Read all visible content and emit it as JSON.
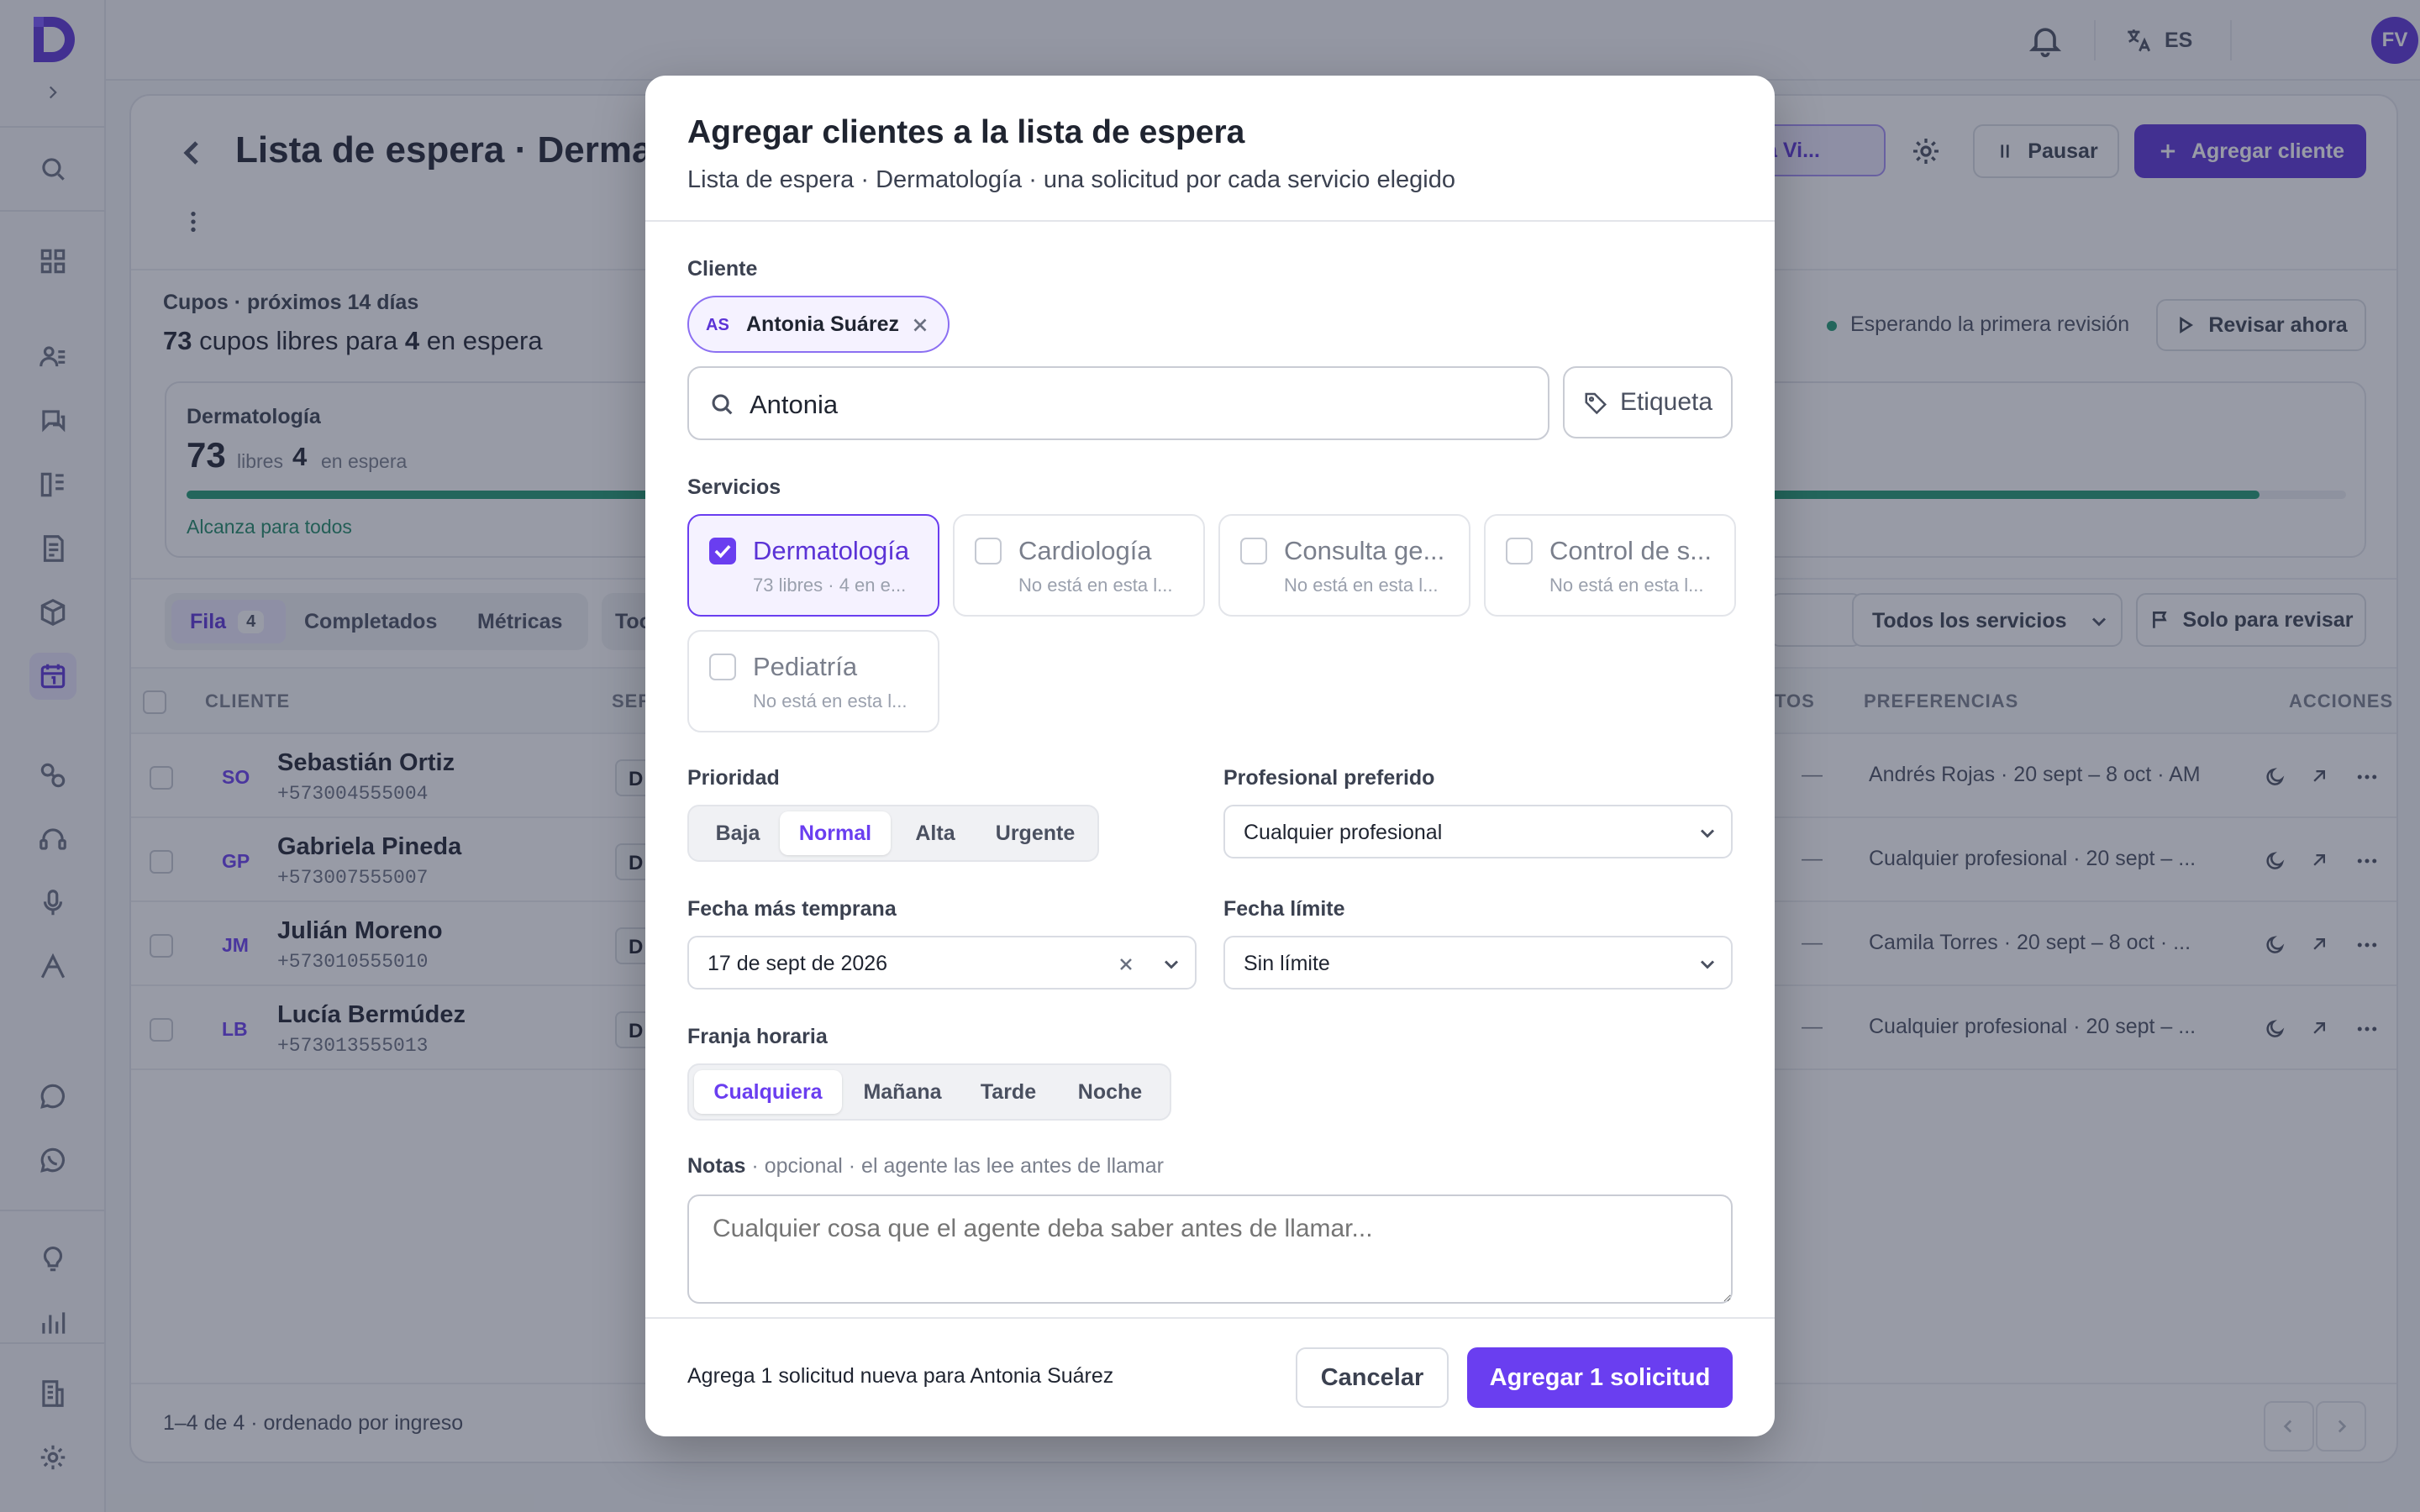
{
  "topbar": {
    "language": "ES",
    "user_initials": "FV"
  },
  "page": {
    "title": "Lista de espera · Dermatol",
    "clinic_chip": "ínica Vi...",
    "pause_label": "Pausar",
    "add_client_label": "Agregar cliente",
    "slots_heading": "Cupos · próximos 14 días",
    "slots_free_count": "73",
    "slots_free_text": "cupos libres para",
    "slots_waiting_count": "4",
    "slots_waiting_text": "en espera",
    "review_status": "Esperando la primera revisión",
    "review_now_label": "Revisar ahora",
    "service_card": {
      "name": "Dermatología",
      "free_count": "73",
      "free_label": "libres",
      "waiting_count": "4",
      "waiting_label": "en espera",
      "status": "Alcanza para todos",
      "progress": 0.96
    },
    "tabs": [
      {
        "label": "Fila",
        "count": "4"
      },
      {
        "label": "Completados"
      },
      {
        "label": "Métricas"
      },
      {
        "label": "Too"
      }
    ],
    "services_filter": "Todos los servicios",
    "review_filter": "Solo para revisar",
    "table_headers": {
      "client": "CLIENTE",
      "service": "SER",
      "appointments": "TOS",
      "preferences": "PREFERENCIAS",
      "actions": "ACCIONES"
    },
    "rows": [
      {
        "initials": "SO",
        "name": "Sebastián Ortiz",
        "phone": "+573004555004",
        "service_tag": "D",
        "dash": "—",
        "preference": "Andrés Rojas · 20 sept – 8 oct · AM"
      },
      {
        "initials": "GP",
        "name": "Gabriela Pineda",
        "phone": "+573007555007",
        "service_tag": "D",
        "dash": "—",
        "preference": "Cualquier profesional · 20 sept – ..."
      },
      {
        "initials": "JM",
        "name": "Julián Moreno",
        "phone": "+573010555010",
        "service_tag": "D",
        "dash": "—",
        "preference": "Camila Torres · 20 sept – 8 oct · ..."
      },
      {
        "initials": "LB",
        "name": "Lucía Bermúdez",
        "phone": "+573013555013",
        "service_tag": "D",
        "dash": "—",
        "preference": "Cualquier profesional · 20 sept – ..."
      }
    ],
    "footer_text": "1–4 de 4 · ordenado por ingreso"
  },
  "modal": {
    "title": "Agregar clientes a la lista de espera",
    "subtitle": "Lista de espera · Dermatología · una solicitud por cada servicio elegido",
    "client_label": "Cliente",
    "selected_client": {
      "initials": "AS",
      "name": "Antonia Suárez"
    },
    "search_value": "Antonia",
    "tag_button": "Etiqueta",
    "services_label": "Servicios",
    "services": [
      {
        "name": "Dermatología",
        "sub": "73 libres · 4 en e...",
        "checked": true
      },
      {
        "name": "Cardiología",
        "sub": "No está en esta l...",
        "checked": false
      },
      {
        "name": "Consulta ge...",
        "sub": "No está en esta l...",
        "checked": false
      },
      {
        "name": "Control de s...",
        "sub": "No está en esta l...",
        "checked": false
      },
      {
        "name": "Pediatría",
        "sub": "No está en esta l...",
        "checked": false
      }
    ],
    "priority_label": "Prioridad",
    "priority_options": [
      "Baja",
      "Normal",
      "Alta",
      "Urgente"
    ],
    "priority_selected": "Normal",
    "professional_label": "Profesional preferido",
    "professional_value": "Cualquier profesional",
    "earliest_label": "Fecha más temprana",
    "earliest_value": "17 de sept de 2026",
    "deadline_label": "Fecha límite",
    "deadline_value": "Sin límite",
    "timeslot_label": "Franja horaria",
    "timeslot_options": [
      "Cualquiera",
      "Mañana",
      "Tarde",
      "Noche"
    ],
    "timeslot_selected": "Cualquiera",
    "notes_label": "Notas",
    "notes_hint": "· opcional · el agente las lee antes de llamar",
    "notes_placeholder": "Cualquier cosa que el agente deba saber antes de llamar...",
    "footer_summary": "Agrega 1 solicitud nueva para Antonia Suárez",
    "cancel_label": "Cancelar",
    "submit_label": "Agregar 1 solicitud"
  },
  "colors": {
    "accent": "#6a3ef0",
    "progress": "#1f9a72",
    "status_dot": "#1f9a72"
  }
}
